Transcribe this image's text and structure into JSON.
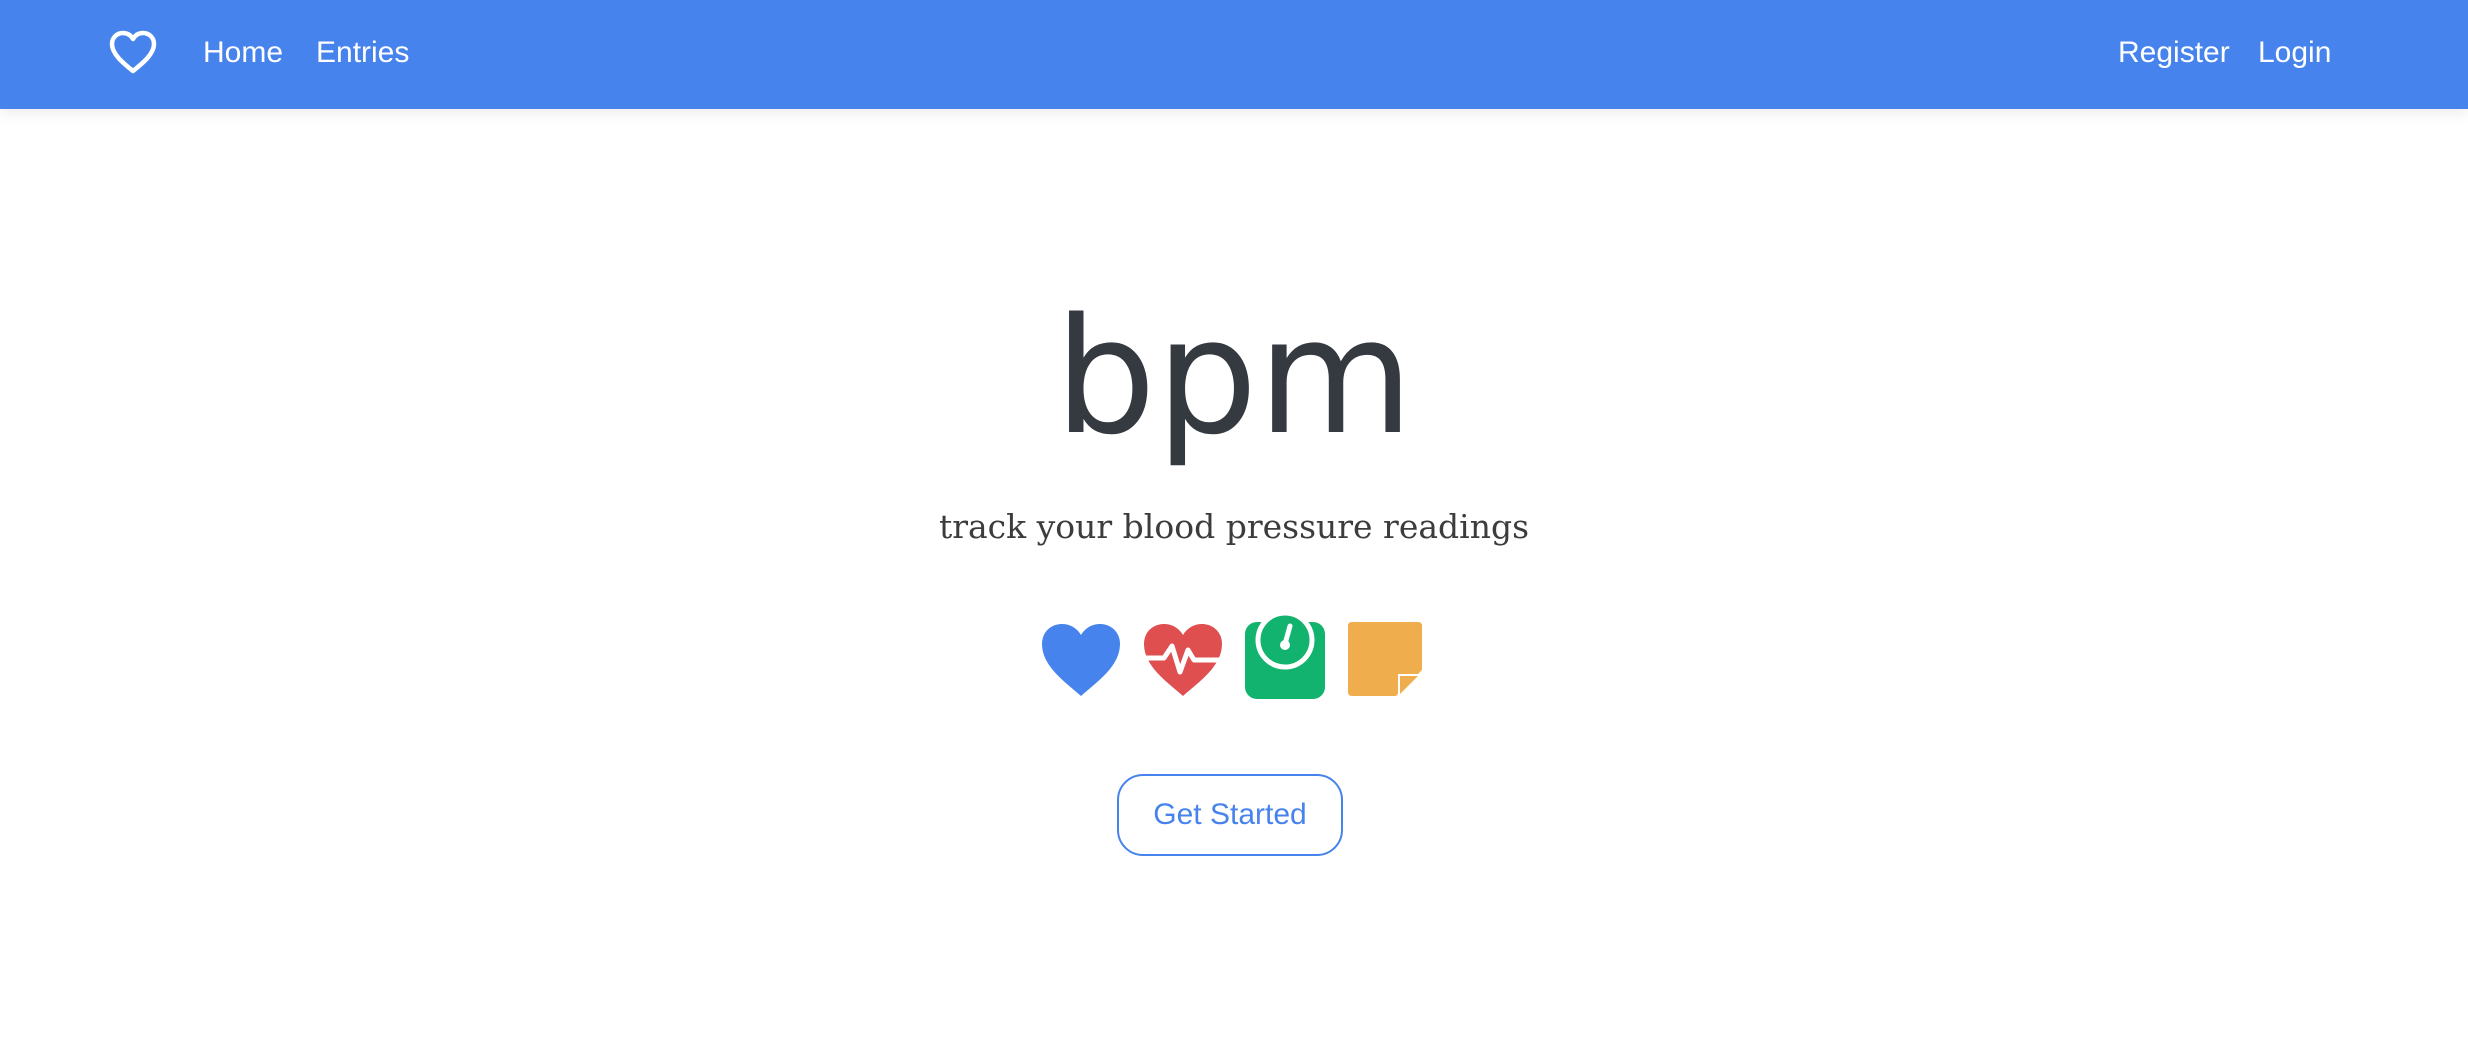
{
  "navbar": {
    "brand_icon": "heart-outline-icon",
    "left_links": [
      {
        "label": "Home"
      },
      {
        "label": "Entries"
      }
    ],
    "right_links": [
      {
        "label": "Register"
      },
      {
        "label": "Login"
      }
    ],
    "background_color": "#4783ec",
    "text_color": "#ffffff"
  },
  "hero": {
    "title": "bpm",
    "subtitle": "track your blood pressure readings",
    "icons": [
      {
        "name": "heart-icon",
        "color": "#4783ec"
      },
      {
        "name": "heartbeat-icon",
        "color": "#e04f4f"
      },
      {
        "name": "weight-scale-icon",
        "color": "#12b26f"
      },
      {
        "name": "sticky-note-icon",
        "color": "#f0ad4e"
      }
    ],
    "cta_label": "Get Started",
    "cta_color": "#4783ec"
  }
}
